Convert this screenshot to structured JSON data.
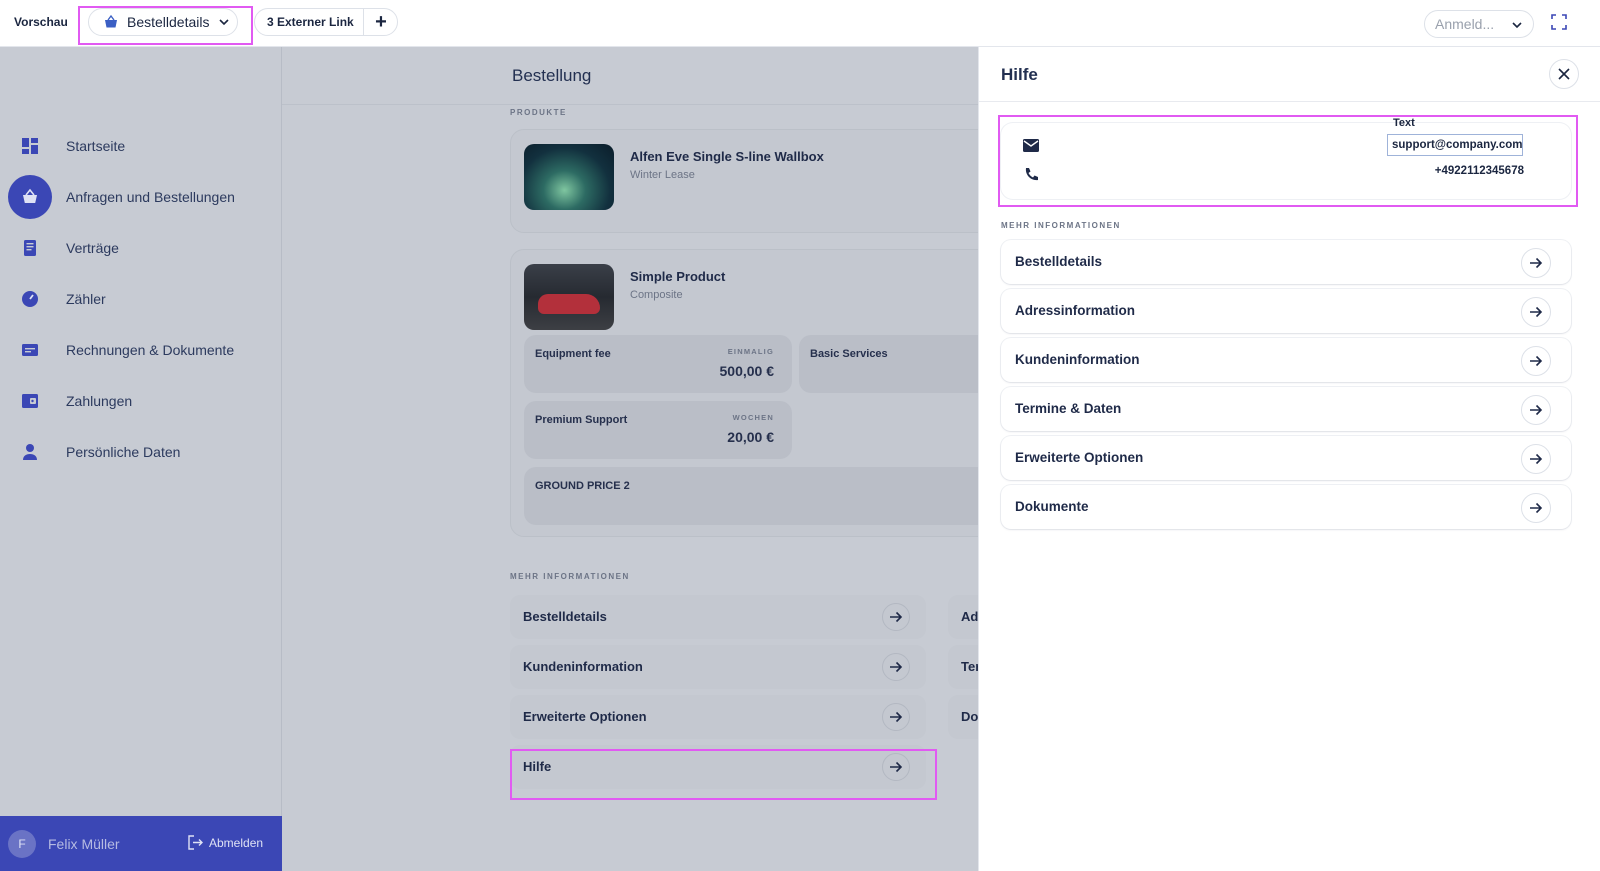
{
  "topbar": {
    "preview_label": "Vorschau",
    "page_select": "Bestelldetails",
    "link_label": "3 Externer Link",
    "add_label": "+",
    "login_select": "Anmeld..."
  },
  "sidebar": {
    "items": [
      {
        "label": "Startseite",
        "icon": "dashboard-icon"
      },
      {
        "label": "Anfragen und Bestellungen",
        "icon": "basket-icon"
      },
      {
        "label": "Verträge",
        "icon": "contract-icon"
      },
      {
        "label": "Zähler",
        "icon": "meter-icon"
      },
      {
        "label": "Rechnungen & Dokumente",
        "icon": "invoice-icon"
      },
      {
        "label": "Zahlungen",
        "icon": "wallet-icon"
      },
      {
        "label": "Persönliche Daten",
        "icon": "person-icon"
      }
    ],
    "active_index": 1,
    "user": {
      "initial": "F",
      "name": "Felix Müller",
      "logout_label": "Abmelden"
    }
  },
  "main": {
    "title": "Bestellung",
    "products_label": "PRODUKTE",
    "products": [
      {
        "name": "Alfen Eve Single S-line Wallbox",
        "subtitle": "Winter Lease"
      },
      {
        "name": "Simple Product",
        "subtitle": "Composite"
      }
    ],
    "fees": [
      {
        "name": "Equipment fee",
        "kind": "EINMALIG",
        "value": "500,00 €"
      },
      {
        "name": "Basic Services"
      },
      {
        "name": "Premium Support",
        "kind": "WOCHEN",
        "value": "20,00 €"
      },
      {
        "name": "GROUND PRICE 2"
      }
    ],
    "more_label": "MEHR INFORMATIONEN",
    "more_left": [
      "Bestelldetails",
      "Kundeninformation",
      "Erweiterte Optionen",
      "Hilfe"
    ],
    "more_right": [
      "Ad",
      "Ter",
      "Do"
    ]
  },
  "panel": {
    "title": "Hilfe",
    "text_label": "Text",
    "email": "support@company.com",
    "phone": "+4922112345678",
    "more_label": "MEHR INFORMATIONEN",
    "items": [
      "Bestelldetails",
      "Adressinformation",
      "Kundeninformation",
      "Termine & Daten",
      "Erweiterte Optionen",
      "Dokumente"
    ]
  },
  "colors": {
    "accent": "#3b47b5",
    "highlight": "#e15af2"
  }
}
